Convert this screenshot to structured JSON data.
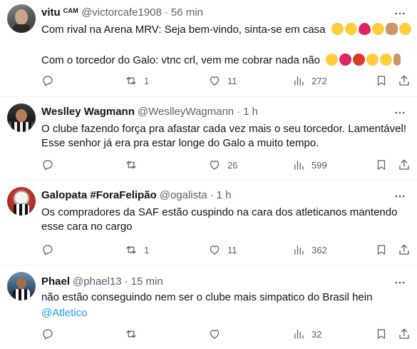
{
  "tweets": [
    {
      "name": "vitu",
      "badge": "CAM",
      "handle": "@victorcafe1908",
      "sep": "·",
      "time": "56 min",
      "lines": [
        "Com rival na Arena MRV: Seja bem-vindo, sinta-se em casa",
        "",
        "Com o torcedor do Galo: vtnc crl, vem me cobrar nada não"
      ],
      "emoji_line1": [
        "smiling-face-with-hearts-icon",
        "star-struck-icon",
        "red-heart-icon",
        "heart-eyes-icon",
        "clapping-hands-icon",
        "partying-face-icon"
      ],
      "emoji_line3": [
        "steam-nose-icon",
        "pouting-face-icon",
        "cursing-face-icon",
        "eye-roll-icon",
        "unamused-face-icon",
        "middle-finger-icon"
      ],
      "stats": {
        "replies": "",
        "reposts": "1",
        "likes": "11",
        "views": "272"
      }
    },
    {
      "name": "Weslley Wagmann",
      "handle": "@WeslleyWagmann",
      "sep": "·",
      "time": "1 h",
      "lines": [
        "O clube fazendo força pra afastar cada vez mais o seu torcedor. Lamentável!",
        "Esse senhor já era pra estar longe do Galo a muito tempo."
      ],
      "stats": {
        "replies": "",
        "reposts": "",
        "likes": "26",
        "views": "599"
      }
    },
    {
      "name": "Galopata #ForaFelipão",
      "handle": "@ogalista",
      "sep": "·",
      "time": "1 h",
      "lines": [
        "Os compradores da SAF estão cuspindo na cara dos atleticanos mantendo",
        "esse cara no cargo"
      ],
      "stats": {
        "replies": "",
        "reposts": "1",
        "likes": "11",
        "views": "362"
      }
    },
    {
      "name": "Phael",
      "handle": "@phael13",
      "sep": "·",
      "time": "15 min",
      "lines": [
        "não estão conseguindo nem ser o clube mais simpatico do Brasil hein",
        "@Atletico"
      ],
      "stats": {
        "replies": "",
        "reposts": "",
        "likes": "",
        "views": "32"
      }
    }
  ],
  "colors": {
    "text": "#0f1419",
    "muted": "#536471",
    "link": "#1d9bf0",
    "divider": "#eff3f4"
  }
}
